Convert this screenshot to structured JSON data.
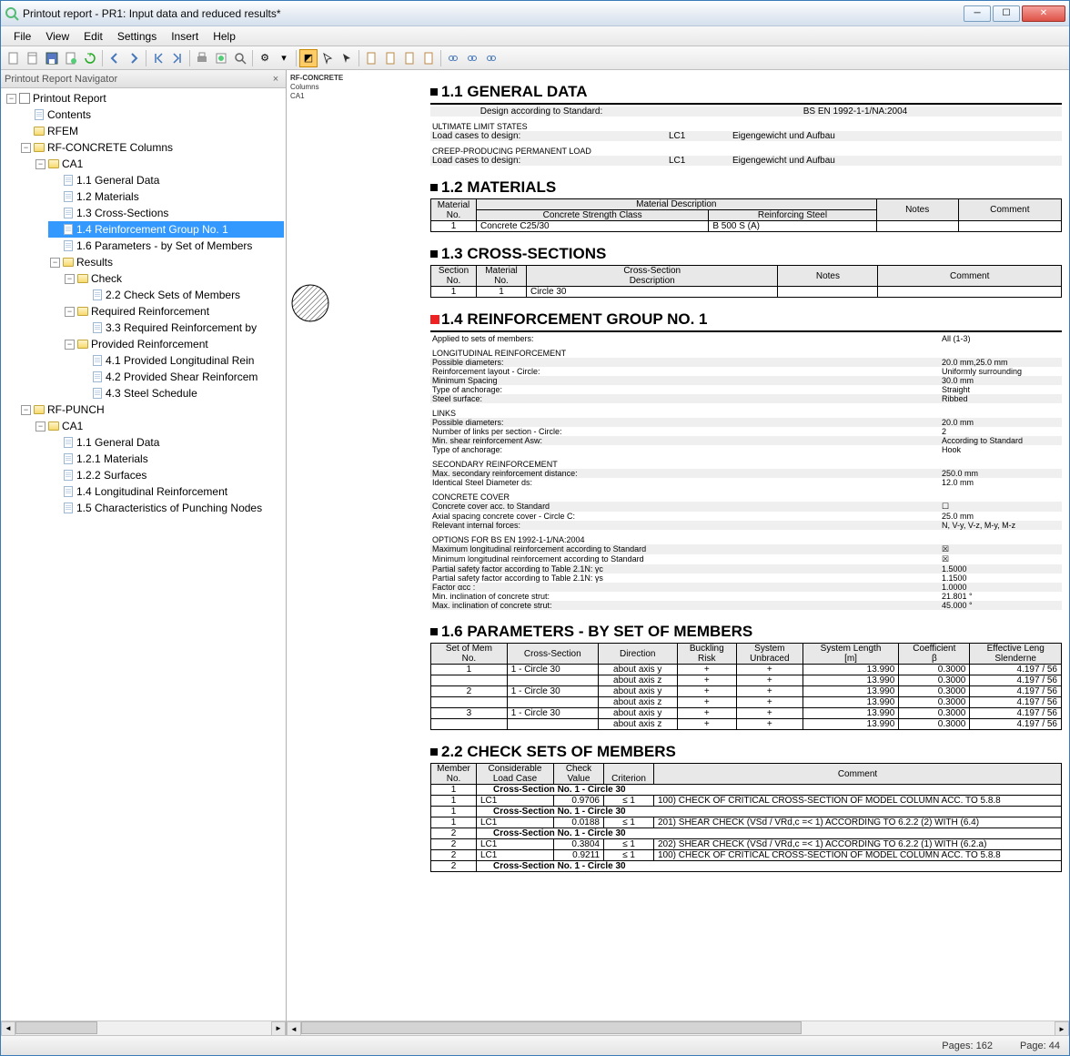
{
  "window": {
    "title": "Printout report - PR1: Input data and reduced results*"
  },
  "menu": [
    "File",
    "View",
    "Edit",
    "Settings",
    "Insert",
    "Help"
  ],
  "nav": {
    "header": "Printout Report Navigator",
    "root": "Printout Report",
    "items": [
      {
        "label": "Contents",
        "type": "page"
      },
      {
        "label": "RFEM",
        "type": "folder"
      },
      {
        "label": "RF-CONCRETE Columns",
        "type": "folder",
        "open": true,
        "children": [
          {
            "label": "CA1",
            "type": "folder",
            "open": true,
            "children": [
              {
                "label": "1.1 General Data",
                "type": "page"
              },
              {
                "label": "1.2 Materials",
                "type": "page"
              },
              {
                "label": "1.3 Cross-Sections",
                "type": "page"
              },
              {
                "label": "1.4 Reinforcement Group No. 1",
                "type": "page",
                "selected": true
              },
              {
                "label": "1.6 Parameters - by Set of Members",
                "type": "page"
              },
              {
                "label": "Results",
                "type": "folder",
                "open": true,
                "children": [
                  {
                    "label": "Check",
                    "type": "folder",
                    "open": true,
                    "children": [
                      {
                        "label": "2.2 Check Sets of Members",
                        "type": "page"
                      }
                    ]
                  },
                  {
                    "label": "Required Reinforcement",
                    "type": "folder",
                    "open": true,
                    "children": [
                      {
                        "label": "3.3 Required Reinforcement by",
                        "type": "page"
                      }
                    ]
                  },
                  {
                    "label": "Provided Reinforcement",
                    "type": "folder",
                    "open": true,
                    "children": [
                      {
                        "label": "4.1 Provided Longitudinal Rein",
                        "type": "page"
                      },
                      {
                        "label": "4.2 Provided Shear Reinforcem",
                        "type": "page"
                      },
                      {
                        "label": "4.3 Steel Schedule",
                        "type": "page"
                      }
                    ]
                  }
                ]
              }
            ]
          }
        ]
      },
      {
        "label": "RF-PUNCH",
        "type": "folder",
        "open": true,
        "children": [
          {
            "label": "CA1",
            "type": "folder",
            "open": true,
            "children": [
              {
                "label": "1.1 General Data",
                "type": "page"
              },
              {
                "label": "1.2.1 Materials",
                "type": "page"
              },
              {
                "label": "1.2.2 Surfaces",
                "type": "page"
              },
              {
                "label": "1.4 Longitudinal Reinforcement",
                "type": "page"
              },
              {
                "label": "1.5 Characteristics of Punching Nodes",
                "type": "page"
              }
            ]
          }
        ]
      }
    ]
  },
  "thumb": {
    "t1": "RF-CONCRETE",
    "t2": "Columns",
    "t3": "CA1"
  },
  "doc": {
    "s11": {
      "title": "1.1 GENERAL DATA",
      "design_label": "Design according to Standard:",
      "design_value": "BS EN 1992-1-1/NA:2004",
      "h1": "ULTIMATE LIMIT STATES",
      "r1l": "Load cases to design:",
      "r1a": "LC1",
      "r1b": "Eigengewicht und Aufbau",
      "h2": "CREEP-PRODUCING PERMANENT LOAD",
      "r2l": "Load cases to design:",
      "r2a": "LC1",
      "r2b": "Eigengewicht und Aufbau"
    },
    "s12": {
      "title": "1.2 MATERIALS",
      "head": {
        "c1a": "Material",
        "c1b": "No.",
        "c2": "Material Description",
        "c2a": "Concrete Strength Class",
        "c2b": "Reinforcing Steel",
        "c3": "Notes",
        "c4": "Comment"
      },
      "row": {
        "no": "1",
        "conc": "Concrete C25/30",
        "steel": "B 500 S (A)",
        "notes": "",
        "comment": ""
      }
    },
    "s13": {
      "title": "1.3 CROSS-SECTIONS",
      "head": {
        "c1a": "Section",
        "c1b": "No.",
        "c2a": "Material",
        "c2b": "No.",
        "c3a": "Cross-Section",
        "c3b": "Description",
        "c4": "Notes",
        "c5": "Comment"
      },
      "row": {
        "sno": "1",
        "mno": "1",
        "desc": "Circle 30",
        "notes": "",
        "comment": ""
      }
    },
    "s14": {
      "title": "1.4 REINFORCEMENT GROUP NO. 1",
      "apply_l": "Applied to sets of members:",
      "apply_v": "All   (1-3)",
      "g1": "LONGITUDINAL REINFORCEMENT",
      "g1r": [
        [
          "Possible diameters:",
          "20.0 mm,25.0 mm"
        ],
        [
          "Reinforcement layout - Circle:",
          "Uniformly surrounding"
        ],
        [
          "Minimum Spacing",
          "30.0 mm"
        ],
        [
          "Type of anchorage:",
          "Straight"
        ],
        [
          "Steel surface:",
          "Ribbed"
        ]
      ],
      "g2": "LINKS",
      "g2r": [
        [
          "Possible diameters:",
          "20.0 mm"
        ],
        [
          "Number of links per section - Circle:",
          "2"
        ],
        [
          "Min. shear reinforcement Asw:",
          "According to Standard"
        ],
        [
          "Type of anchorage:",
          "Hook"
        ]
      ],
      "g3": "SECONDARY REINFORCEMENT",
      "g3r": [
        [
          "Max. secondary reinforcement distance:",
          "250.0 mm"
        ],
        [
          "Identical Steel Diameter ds:",
          "12.0 mm"
        ]
      ],
      "g4": "CONCRETE COVER",
      "g4r": [
        [
          "Concrete cover acc. to Standard",
          "☐"
        ],
        [
          "Axial spacing concrete cover - Circle C:",
          "25.0 mm"
        ],
        [
          "Relevant internal forces:",
          "N, V-y, V-z, M-y, M-z"
        ]
      ],
      "g5": "OPTIONS FOR BS EN 1992-1-1/NA:2004",
      "g5r": [
        [
          "Maximum longitudinal reinforcement according to Standard",
          "☒"
        ],
        [
          "Minimum longitudinal reinforcement according to Standard",
          "☒"
        ],
        [
          "Partial safety factor according to Table 2.1N: γc",
          "1.5000"
        ],
        [
          "Partial safety factor according to Table 2.1N: γs",
          "1.1500"
        ],
        [
          "Factor αcc :",
          "1.0000"
        ],
        [
          "Min. inclination of concrete strut:",
          "21.801 °"
        ],
        [
          "Max. inclination of concrete strut:",
          "45.000 °"
        ]
      ]
    },
    "s16": {
      "title": "1.6 PARAMETERS - BY SET OF MEMBERS",
      "head": [
        "Set of Mem\nNo.",
        "Cross-Section",
        "Direction",
        "Buckling\nRisk",
        "System\nUnbraced",
        "System Length\n[m]",
        "Coefficient\nβ",
        "Effective Leng\nSlenderne"
      ],
      "rows": [
        [
          "1",
          "1 - Circle 30",
          "about axis y",
          "+",
          "+",
          "13.990",
          "0.3000",
          "4.197 / 56"
        ],
        [
          "",
          "",
          "about axis z",
          "+",
          "+",
          "13.990",
          "0.3000",
          "4.197 / 56"
        ],
        [
          "2",
          "1 - Circle 30",
          "about axis y",
          "+",
          "+",
          "13.990",
          "0.3000",
          "4.197 / 56"
        ],
        [
          "",
          "",
          "about axis z",
          "+",
          "+",
          "13.990",
          "0.3000",
          "4.197 / 56"
        ],
        [
          "3",
          "1 - Circle 30",
          "about axis y",
          "+",
          "+",
          "13.990",
          "0.3000",
          "4.197 / 56"
        ],
        [
          "",
          "",
          "about axis z",
          "+",
          "+",
          "13.990",
          "0.3000",
          "4.197 / 56"
        ]
      ]
    },
    "s22": {
      "title": "2.2 CHECK SETS OF MEMBERS",
      "head": [
        "Member\nNo.",
        "Considerable\nLoad Case",
        "Check\nValue",
        "\nCriterion",
        "Comment"
      ],
      "rows": [
        {
          "m": "1",
          "sec": "Cross-Section No. 1 - Circle 30"
        },
        {
          "m": "1",
          "lc": "LC1",
          "val": "0.9706",
          "crit": "≤ 1",
          "cmt": "100) CHECK OF CRITICAL CROSS-SECTION OF MODEL COLUMN ACC. TO 5.8.8"
        },
        {
          "m": "1",
          "sec": "Cross-Section No. 1 - Circle 30"
        },
        {
          "m": "1",
          "lc": "LC1",
          "val": "0.0188",
          "crit": "≤ 1",
          "cmt": "201) SHEAR CHECK (VSd / VRd,c =< 1) ACCORDING TO 6.2.2 (2) WITH (6.4)"
        },
        {
          "m": "2",
          "sec": "Cross-Section No. 1 - Circle 30"
        },
        {
          "m": "2",
          "lc": "LC1",
          "val": "0.3804",
          "crit": "≤ 1",
          "cmt": "202) SHEAR CHECK (VSd / VRd,c =< 1) ACCORDING TO 6.2.2 (1) WITH (6.2.a)"
        },
        {
          "m": "2",
          "lc": "LC1",
          "val": "0.9211",
          "crit": "≤ 1",
          "cmt": "100) CHECK OF CRITICAL CROSS-SECTION OF MODEL COLUMN ACC. TO 5.8.8"
        },
        {
          "m": "2",
          "sec": "Cross-Section No. 1 - Circle 30"
        }
      ]
    }
  },
  "status": {
    "pages": "Pages: 162",
    "page": "Page: 44"
  }
}
